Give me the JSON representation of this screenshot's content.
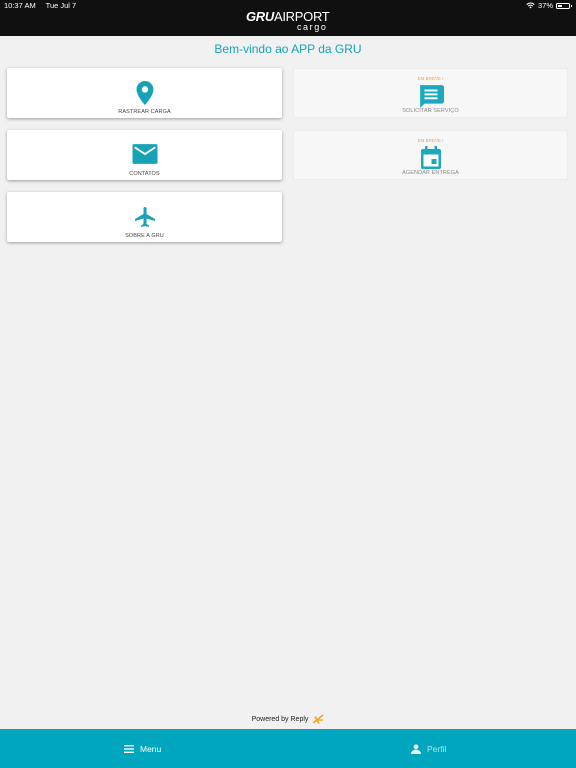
{
  "status_bar": {
    "time": "10:37 AM",
    "date": "Tue Jul 7",
    "battery": "37%",
    "battery_level": 0.37
  },
  "header": {
    "logo_top_bold": "GRU",
    "logo_top_light": "AIRPORT",
    "logo_bottom": "cargo"
  },
  "welcome": "Bem-vindo ao APP da GRU",
  "cards": {
    "rastrear": {
      "label": "RASTREAR CARGA",
      "icon": "location-pin-icon"
    },
    "solicitar": {
      "badge": "EM BREVE !",
      "label": "SOLICITAR SERVIÇO",
      "icon": "chat-message-icon"
    },
    "contatos": {
      "label": "CONTATOS",
      "icon": "mail-icon"
    },
    "agendar": {
      "badge": "EM BREVE !",
      "label": "AGENDAR ENTREGA",
      "icon": "calendar-icon"
    },
    "sobre": {
      "label": "SOBRE A GRU",
      "icon": "airplane-icon"
    }
  },
  "powered_by": "Powered by Reply",
  "footer": {
    "menu_label": "Menu",
    "perfil_label": "Perfil"
  },
  "colors": {
    "accent": "#16a3b8",
    "footer": "#00a6bd",
    "header": "#101010",
    "badge": "#f0a060"
  }
}
